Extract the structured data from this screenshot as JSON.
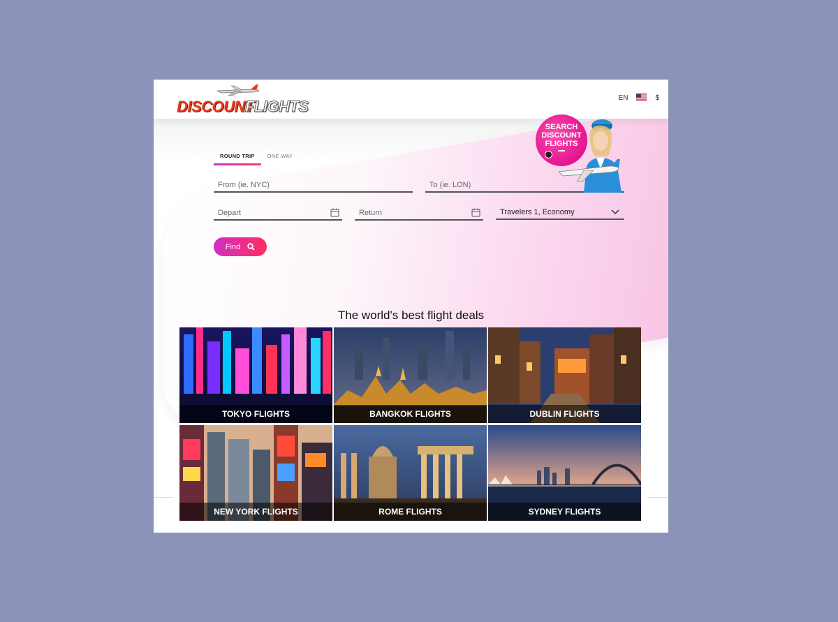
{
  "header": {
    "logo_word1": "DISCOUNT",
    "logo_word2": "FLIGHTS",
    "language": "EN",
    "currency": "$",
    "flag_icon": "us-flag-icon"
  },
  "search": {
    "tabs": [
      {
        "label": "ROUND TRIP",
        "active": true
      },
      {
        "label": "ONE WAY",
        "active": false
      }
    ],
    "from_placeholder": "From (ie. NYC)",
    "to_placeholder": "To (ie. LON)",
    "depart_placeholder": "Depart",
    "return_placeholder": "Return",
    "travelers_value": "Travelers 1, Economy",
    "find_label": "Find"
  },
  "badge": {
    "line1": "SEARCH",
    "line2": "DISCOUNT",
    "line3": "FLIGHTS"
  },
  "deals": {
    "title": "The world's best flight deals",
    "tiles": [
      {
        "label": "TOKYO FLIGHTS",
        "color": "#1a2a8a"
      },
      {
        "label": "BANGKOK FLIGHTS",
        "color": "#2b3f5e"
      },
      {
        "label": "DUBLIN FLIGHTS",
        "color": "#6b4a2a"
      },
      {
        "label": "NEW YORK FLIGHTS",
        "color": "#7a3a50"
      },
      {
        "label": "ROME FLIGHTS",
        "color": "#4a4a6a"
      },
      {
        "label": "SYDNEY FLIGHTS",
        "color": "#2a5080"
      }
    ]
  },
  "colors": {
    "accent_start": "#c42fd3",
    "accent_end": "#ff3d63",
    "logo_red": "#e83a1f"
  }
}
